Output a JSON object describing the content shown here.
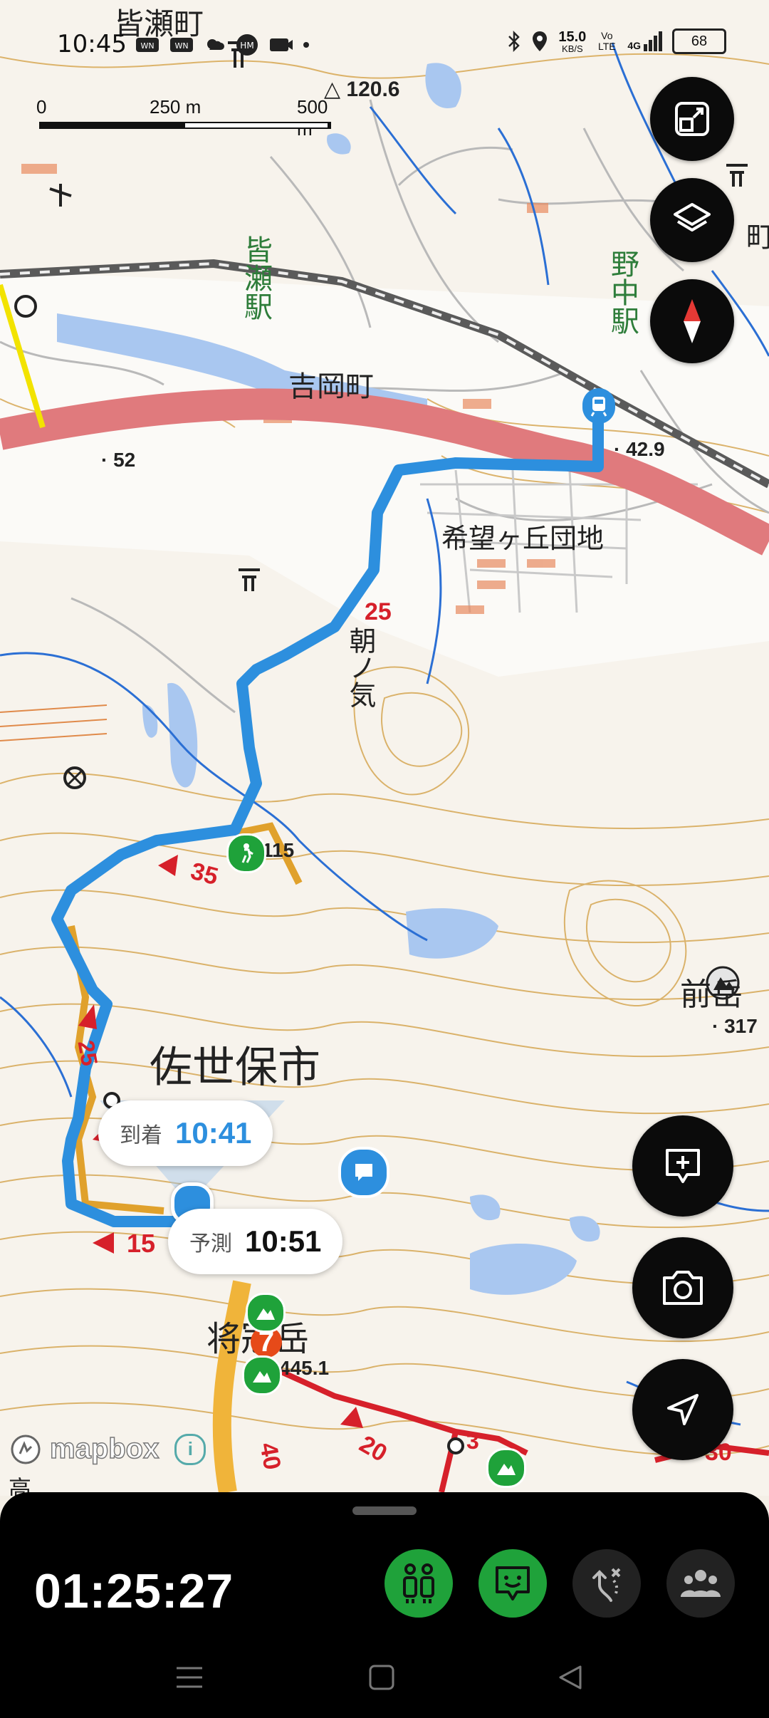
{
  "status_bar": {
    "time": "10:45",
    "net_speed": "15.0",
    "net_unit": "KB/S",
    "volte": "Vo LTE",
    "signal": "4G",
    "battery": "68"
  },
  "scale": {
    "label_0": "0",
    "label_250": "250 m",
    "label_500": "500 m"
  },
  "map_labels": {
    "town_top": "皆瀬町",
    "station_minase": "皆瀬駅",
    "station_nonaka": "野中駅",
    "town_yoshioka": "吉岡町",
    "danchi": "希望ヶ丘団地",
    "place_asanoke": "朝ノ気",
    "city": "佐世保市",
    "peak_mae": "前岳",
    "peak_sho": "将冠岳",
    "elev_1206": "120.6",
    "elev_52": "52",
    "elev_429": "42.9",
    "elev_115": "115",
    "elev_317": "317",
    "elev_4451": "445.1",
    "town_right": "町",
    "sub_bottom": "高"
  },
  "route_markers": {
    "m25": "25",
    "m35": "35",
    "m25b": "25",
    "m15": "15",
    "m40": "40",
    "m20": "20",
    "m30": "30",
    "m3": "3",
    "m7": "7"
  },
  "bubbles": {
    "arrival_label": "到着",
    "arrival_time": "10:41",
    "predict_label": "予測",
    "predict_time": "10:51"
  },
  "attribution": {
    "logo": "mapbox",
    "info": "i"
  },
  "bottom_sheet": {
    "elapsed": "01:25:27"
  },
  "colors": {
    "route_blue": "#2d8fde",
    "route_red": "#d6202a",
    "accent_green": "#1fa23a",
    "sheet_bg": "#000000",
    "fab_bg": "#0b0b0b"
  },
  "icons": {
    "fab_1": "fullscreen-icon",
    "fab_2": "layers-icon",
    "fab_3": "compass-icon",
    "fab_4": "add-comment-icon",
    "fab_5": "camera-icon",
    "fab_6": "navigate-icon",
    "tool_1": "group-walk-icon",
    "tool_2": "message-icon",
    "tool_3": "route-edit-icon",
    "tool_4": "community-icon"
  }
}
